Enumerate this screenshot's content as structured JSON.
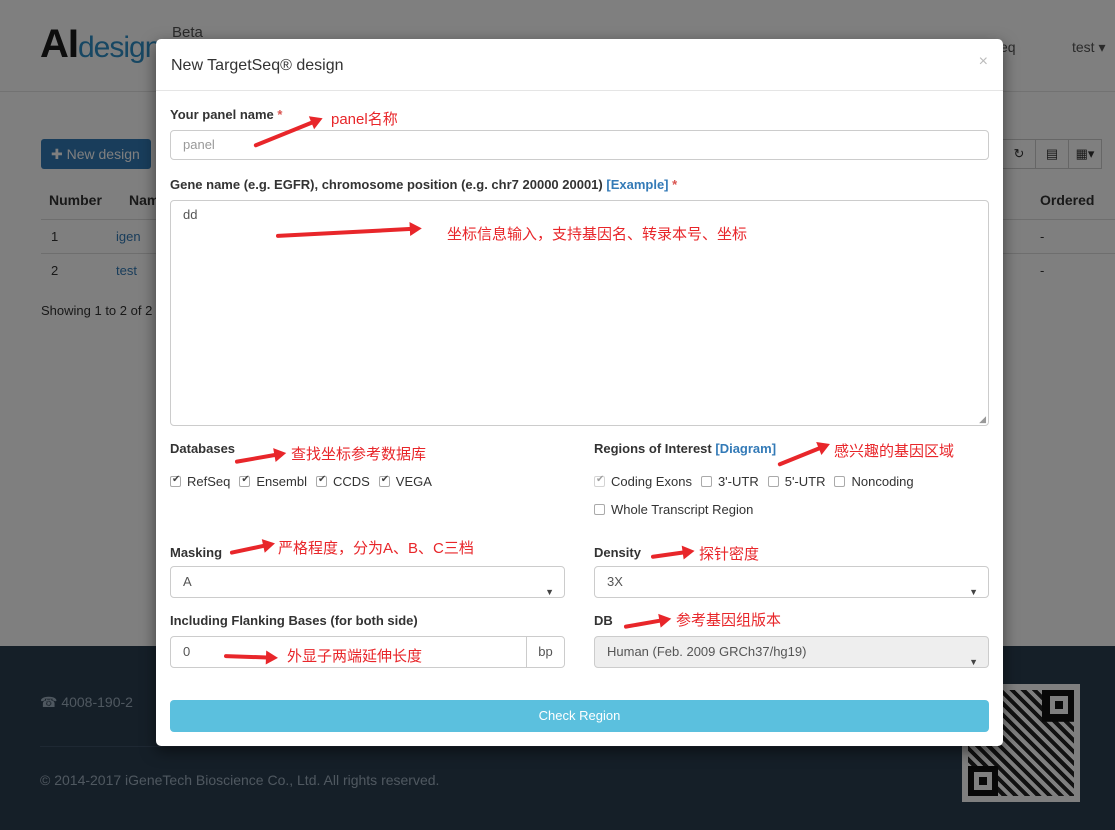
{
  "background": {
    "logo_ai": "AI",
    "logo_design": "design",
    "beta": "Beta",
    "nav_targetseq": "eq",
    "nav_user": "test ▾",
    "new_design": "✚ New design",
    "tool_icons": [
      "refresh-icon",
      "list-icon",
      "columns-icon"
    ],
    "tool_glyphs": [
      "↻",
      "▤",
      "▦▾"
    ],
    "table": {
      "headers": [
        "Number",
        "Nam",
        "Ordered"
      ],
      "rows": [
        {
          "number": "1",
          "name": "igen",
          "ordered": "-"
        },
        {
          "number": "2",
          "name": "test",
          "ordered": "-"
        }
      ],
      "showing": "Showing 1 to 2 of 2"
    },
    "footer": {
      "phone": "☎  4008-190-2",
      "copyright": "© 2014-2017 iGeneTech Bioscience Co., Ltd. All rights reserved."
    }
  },
  "modal": {
    "title": "New TargetSeq® design",
    "close": "×",
    "panel_label": "Your panel name",
    "required": "*",
    "panel_placeholder": "panel",
    "gene_label": "Gene name (e.g. EGFR), chromosome position (e.g. chr7 20000 20001)",
    "example_link": "[Example]",
    "gene_value": "dd",
    "databases_label": "Databases",
    "databases": [
      {
        "label": "RefSeq",
        "checked": true
      },
      {
        "label": "Ensembl",
        "checked": true
      },
      {
        "label": "CCDS",
        "checked": true
      },
      {
        "label": "VEGA",
        "checked": true
      }
    ],
    "regions_label": "Regions of Interest",
    "diagram_link": "[Diagram]",
    "regions": [
      {
        "label": "Coding Exons",
        "checked": true
      },
      {
        "label": "3'-UTR",
        "checked": false
      },
      {
        "label": "5'-UTR",
        "checked": false
      },
      {
        "label": "Noncoding",
        "checked": false
      }
    ],
    "whole_transcript": "Whole Transcript Region",
    "masking_label": "Masking",
    "masking_value": "A",
    "density_label": "Density",
    "density_value": "3X",
    "flanking_label": "Including Flanking Bases (for both side)",
    "flanking_value": "0",
    "flanking_unit": "bp",
    "db_label": "DB",
    "db_value": "Human (Feb. 2009 GRCh37/hg19)",
    "check_button": "Check Region"
  },
  "annotations": {
    "panel": "panel名称",
    "gene": "坐标信息输入，支持基因名、转录本号、坐标",
    "databases": "查找坐标参考数据库",
    "regions": "感兴趣的基因区域",
    "masking": "严格程度，分为A、B、C三档",
    "density": "探针密度",
    "db": "参考基因组版本",
    "flanking": "外显子两端延伸长度",
    "color": "#e8262a"
  }
}
